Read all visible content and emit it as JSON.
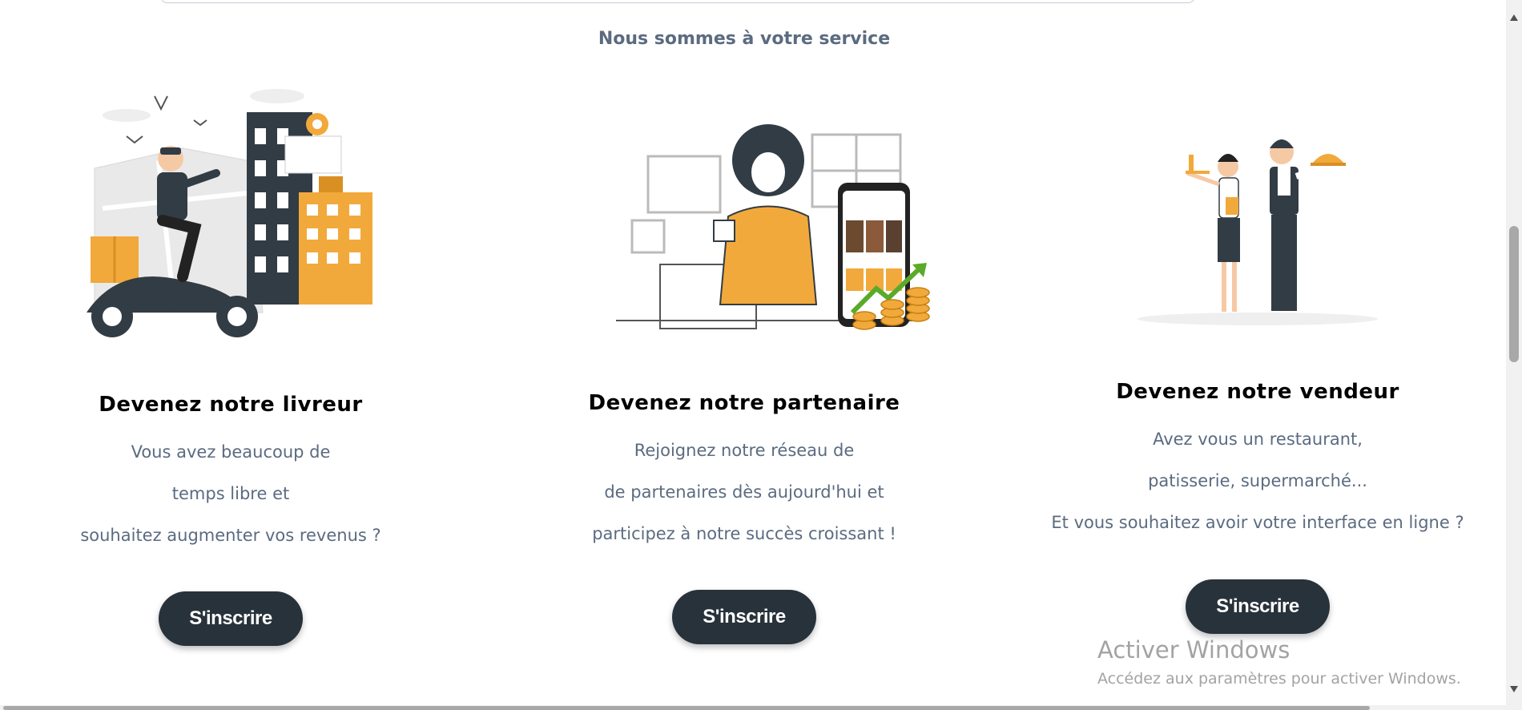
{
  "section": {
    "title": "Nous sommes à votre service"
  },
  "cards": [
    {
      "title": "Devenez notre livreur",
      "description": [
        "Vous avez beaucoup de",
        "temps libre et",
        "souhaitez augmenter vos revenus ?"
      ],
      "button_label": "S'inscrire",
      "illustration": "delivery-scooter-illustration"
    },
    {
      "title": "Devenez notre partenaire",
      "description": [
        "Rejoignez notre réseau de",
        "de partenaires dès aujourd'hui et",
        "participez à notre succès croissant !"
      ],
      "button_label": "S'inscrire",
      "illustration": "partner-phone-illustration"
    },
    {
      "title": "Devenez notre vendeur",
      "description": [
        "Avez vous un restaurant,",
        "patisserie, supermarché...",
        "Et vous souhaitez avoir votre interface en ligne ?"
      ],
      "button_label": "S'inscrire",
      "illustration": "waiters-illustration"
    }
  ],
  "watermark": {
    "title": "Activer Windows",
    "subtitle": "Accédez aux paramètres pour activer Windows."
  },
  "colors": {
    "button_bg": "#28323b",
    "text_muted": "#5b6b80",
    "accent": "#f2a93b",
    "dark": "#323c44"
  }
}
